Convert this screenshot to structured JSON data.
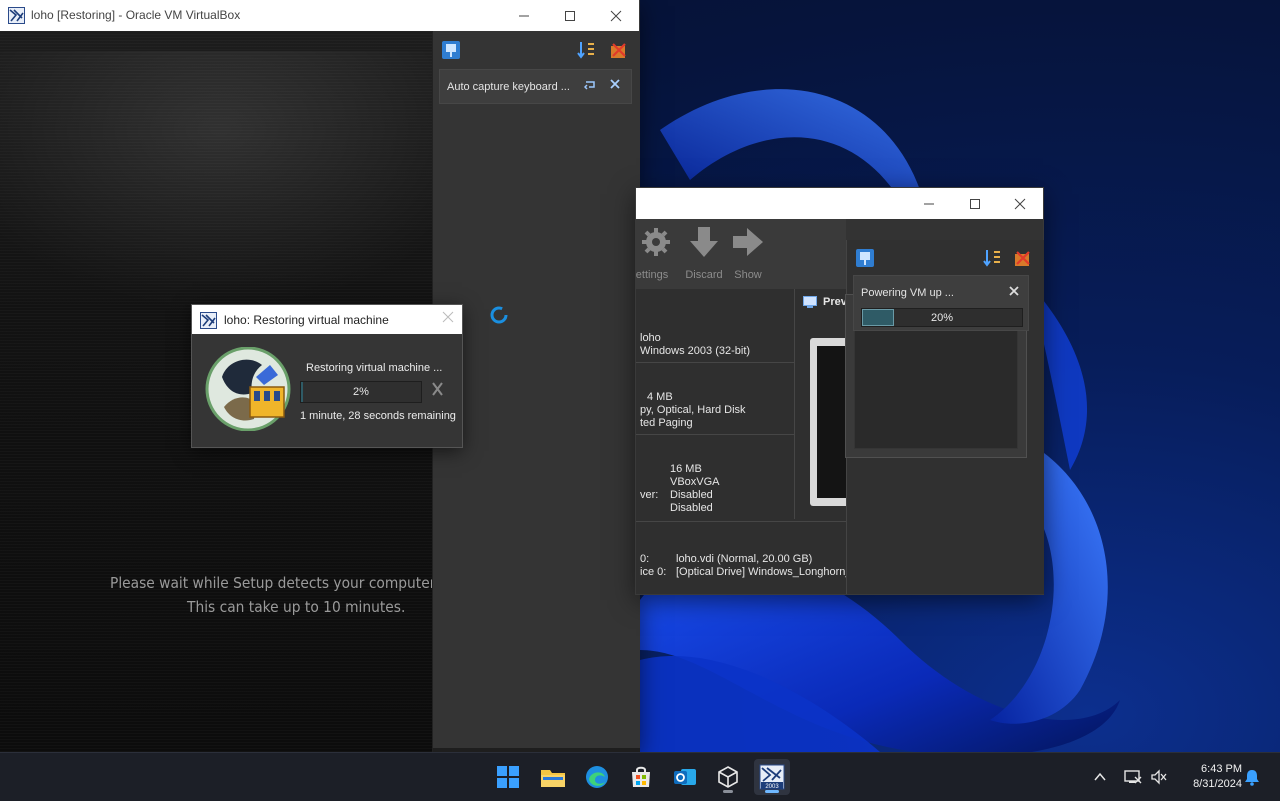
{
  "vm_window": {
    "title": "loho [Restoring] - Oracle VM VirtualBox",
    "setup_line1": "Please wait while Setup detects your computer's hardware",
    "setup_line2": "This can take up to 10 minutes.",
    "notification": {
      "text": "Auto capture keyboard ..."
    }
  },
  "restore_dialog": {
    "title": "loho: Restoring virtual machine",
    "status": "Restoring virtual machine ...",
    "progress_label": "2%",
    "progress_value": 0.02,
    "remaining": "1 minute, 28 seconds remaining"
  },
  "manager_window": {
    "toolbar": [
      {
        "label": "ettings",
        "icon": "gear-icon"
      },
      {
        "label": "Discard",
        "icon": "discard-arrow-icon"
      },
      {
        "label": "Show",
        "icon": "show-arrow-icon"
      }
    ],
    "preview_label": "Prev",
    "details": {
      "general": [
        "loho",
        "Windows 2003 (32-bit)"
      ],
      "system": [
        "4 MB",
        "py, Optical, Hard Disk",
        "ted Paging"
      ],
      "display_values": [
        "16 MB",
        "VBoxVGA",
        "Disabled",
        "Disabled"
      ],
      "display_key": "ver:",
      "storage": [
        {
          "key": "0:",
          "value": "loho.vdi (Normal, 20.00 GB)"
        },
        {
          "key": "ice 0:",
          "value": "[Optical Drive] Windows_Longhorn_..."
        }
      ]
    },
    "notification": {
      "text": "Powering VM up ...",
      "progress_label": "20%",
      "progress_value": 0.2
    }
  },
  "taskbar": {
    "apps": [
      {
        "name": "start",
        "icon": "windows-start-icon",
        "active": false
      },
      {
        "name": "file-explorer",
        "icon": "folder-icon",
        "active": false
      },
      {
        "name": "edge",
        "icon": "edge-browser-icon",
        "active": false
      },
      {
        "name": "store",
        "icon": "store-icon",
        "active": false
      },
      {
        "name": "outlook",
        "icon": "outlook-icon",
        "active": false
      },
      {
        "name": "virtualbox",
        "icon": "virtualbox-icon",
        "active": false
      },
      {
        "name": "vm-loho",
        "icon": "vm-2003-icon",
        "active": true
      }
    ],
    "vm_icon_label": "2003",
    "time": "6:43 PM",
    "date": "8/31/2024"
  }
}
